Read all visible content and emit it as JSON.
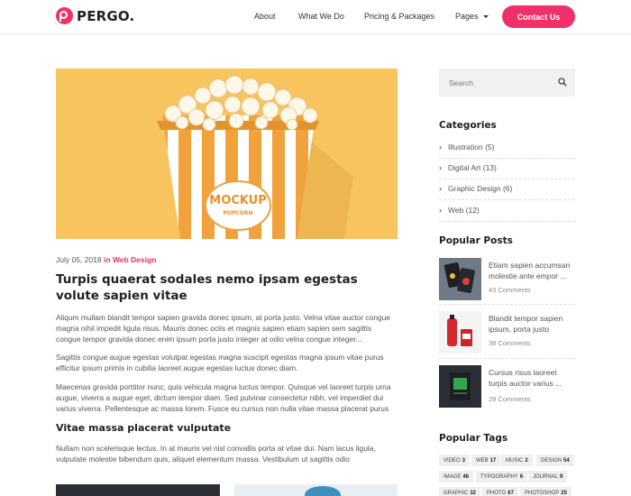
{
  "brand": {
    "name": "PERGO.",
    "accent": "#f0306b"
  },
  "nav": {
    "items": [
      "About",
      "What We Do",
      "Pricing & Packages",
      "Pages"
    ],
    "cta": "Contact Us"
  },
  "post": {
    "date": "July 05, 2018",
    "in_text": "in",
    "category": "Web Design",
    "title": "Turpis quaerat sodales nemo ipsam egestas volute sapien vitae",
    "hero_box_text": [
      "MOCKUP",
      "POPCORN"
    ],
    "paragraphs": [
      "Aliqum mullam blandit tempor sapien gravida donec ipsum, at porta justo. Velna vitae auctor congue magna nihil impedit ligula risus. Mauris donec ociis et magnis sapien etiam sapien sem sagittis congue tempor gravida donec enim ipsum porta justo integer at odio velna congue integer...",
      "Sagittis congue augue egestas volutpat egestas magna suscipit egestas magna ipsum vitae purus efficitur ipsum primis in cubilia laoreet augue egestas luctus donec diam.",
      "Maecenas gravida porttitor nunc, quis vehicula magna luctus tempor. Quisque vel laoreet turpis urna augue, viverra a augue eget, dictum tempor diam. Sed pulvinar consectetur nibh, vel imperdiet dui varius viverra. Pellentesque ac massa lorem. Fusce eu cursus non nulla vitae massa placerat purus"
    ],
    "subheading": "Vitae massa placerat vulputate",
    "paragraph_after": "Nullam non scelerisque lectus. In at mauris vel nisl convallis porta at vitae dui. Nam lacus ligula, vulputate molestie bibendum quis, aliquet elementum massa. Vestibulum ut sagittis odio"
  },
  "sidebar": {
    "search_placeholder": "Search",
    "categories_title": "Categories",
    "categories": [
      {
        "label": "Illustration (5)"
      },
      {
        "label": "Digital Art (13)"
      },
      {
        "label": "Graphic Design (6)"
      },
      {
        "label": "Web (12)"
      }
    ],
    "popular_title": "Popular Posts",
    "popular": [
      {
        "title": "Etiam sapien accumsan molestie ante empor ...",
        "comments": "43 Comments"
      },
      {
        "title": "Blandit tempor sapien ipsum, porta justo",
        "comments": "38 Comments"
      },
      {
        "title": "Cursus risus laoreet turpis auctor varius ...",
        "comments": "29 Comments"
      }
    ],
    "tags_title": "Popular Tags",
    "tags": [
      {
        "name": "VIDEO",
        "count": "3"
      },
      {
        "name": "WEB",
        "count": "17"
      },
      {
        "name": "MUSIC",
        "count": "2"
      },
      {
        "name": "DESIGN",
        "count": "54"
      },
      {
        "name": "IMAGE",
        "count": "46"
      },
      {
        "name": "TYPOGRAPHY",
        "count": "6"
      },
      {
        "name": "JOURNAL",
        "count": "9"
      },
      {
        "name": "GRAPHIC",
        "count": "32"
      },
      {
        "name": "PHOTO",
        "count": "67"
      },
      {
        "name": "PHOTOSHOP",
        "count": "25"
      }
    ]
  }
}
